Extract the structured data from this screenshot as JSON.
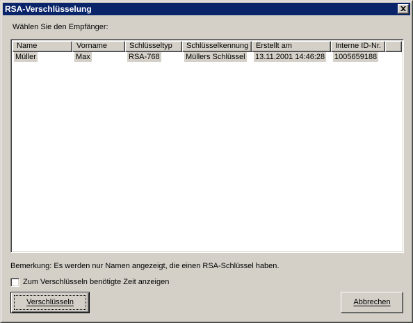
{
  "window": {
    "title": "RSA-Verschlüsselung"
  },
  "prompt_label": "Wählen Sie den Empfänger:",
  "table": {
    "columns": [
      "Name",
      "Vorname",
      "Schlüsseltyp",
      "Schlüsselkennung",
      "Erstellt am",
      "Interne ID-Nr."
    ],
    "rows": [
      [
        "Müller",
        "Max",
        "RSA-768",
        "Müllers Schlüssel",
        "13.11.2001 14:46:28",
        "1005659188"
      ]
    ]
  },
  "note": "Bemerkung: Es werden nur Namen angezeigt, die einen RSA-Schlüssel haben.",
  "checkbox": {
    "label": "Zum Verschlüsseln benötigte Zeit anzeigen",
    "checked": false
  },
  "buttons": {
    "encrypt": "Verschlüsseln",
    "cancel": "Abbrechen"
  },
  "colors": {
    "titlebar": "#0a246a",
    "face": "#d4d0c8",
    "selection": "#d4d0c8"
  },
  "icons": {
    "close": "close-icon"
  }
}
